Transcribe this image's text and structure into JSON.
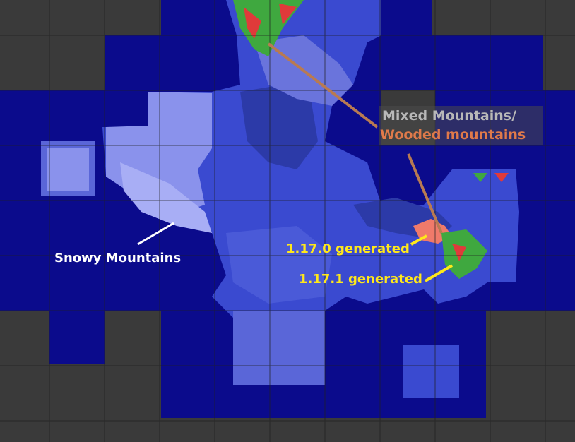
{
  "map": {
    "colors": {
      "background_tile": "#3a3a3a",
      "grid_line": "#1f1f1f",
      "ocean": "#0b0b8c",
      "land_blue": "#3a4ad0",
      "land_light": "#8a92ec",
      "snow": "#a8aef5",
      "forest": "#2c3aa8",
      "mountain_peaks": "#3fa83f",
      "peak_red": "#e03a3a",
      "old_gen_patch": "#f07a6a",
      "pointer_white": "#ffffff",
      "pointer_brown": "#b87a52",
      "pointer_yellow": "#ffe81a"
    }
  },
  "labels": {
    "snowy": "Snowy Mountains",
    "mixed": "Mixed Mountains/",
    "wooded": "Wooded mountains",
    "gen_1170": "1.17.0 generated",
    "gen_1171": "1.17.1 generated"
  }
}
